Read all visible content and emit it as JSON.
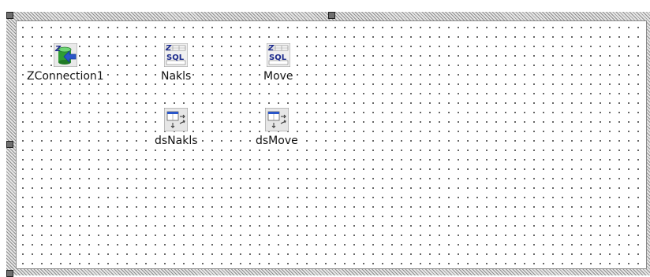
{
  "components": [
    {
      "name": "ZConnection1",
      "icon": "database-connection-icon"
    },
    {
      "name": "Nakls",
      "icon": "sql-query-icon"
    },
    {
      "name": "Move",
      "icon": "sql-query-icon"
    },
    {
      "name": "dsNakls",
      "icon": "datasource-icon"
    },
    {
      "name": "dsMove",
      "icon": "datasource-icon"
    }
  ],
  "colors": {
    "canvas_bg": "#ffffff",
    "grid_dot": "#3c3c3c",
    "handle": "#6f6f6f",
    "sql_text": "#1b2a8c",
    "db_green": "#2f9d33",
    "arrow_blue": "#2a56c9"
  }
}
